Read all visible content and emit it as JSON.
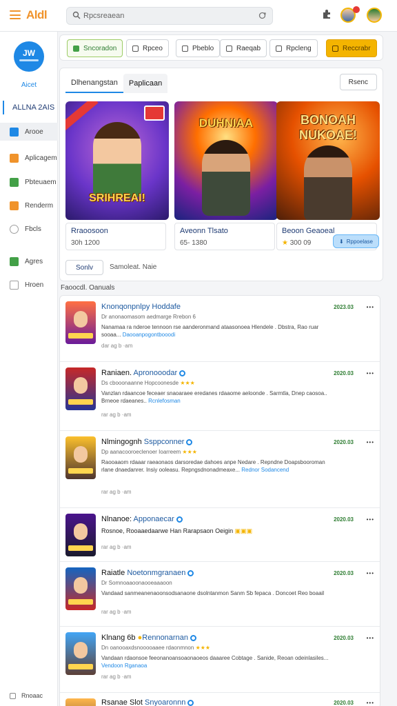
{
  "topbar": {
    "brand": "Aldl",
    "search_text": "Rpcsreaean"
  },
  "sidebar": {
    "logo_text": "JW",
    "logo_label": "Aicet",
    "heading": "ALLNA 2AIS",
    "items": [
      {
        "label": "Arooe",
        "icon": "app-icon",
        "color": "#1e88e5"
      },
      {
        "label": "Aplicagem",
        "icon": "apps-icon",
        "color": "#f0932b"
      },
      {
        "label": "Pbteuaem",
        "icon": "d-icon",
        "color": "#43a047"
      },
      {
        "label": "Renderm",
        "icon": "grid-icon",
        "color": "#f0932b"
      },
      {
        "label": "Fbcls",
        "icon": "user-icon",
        "color": "#9e9e9e"
      },
      {
        "label": "Agres",
        "icon": "check-icon",
        "color": "#43a047"
      },
      {
        "label": "Hroen",
        "icon": "doc-icon",
        "color": "#9e9e9e"
      }
    ],
    "bottom_label": "Rnoaac"
  },
  "pills": [
    {
      "label": "Sncoradon",
      "style": "green"
    },
    {
      "label": "Rpceo",
      "style": "plain"
    },
    {
      "label": "Pbeblo",
      "style": "plain"
    },
    {
      "label": "Raeqab",
      "style": "plain"
    },
    {
      "label": "Rpcleng",
      "style": "plain"
    },
    {
      "label": "Reccrabr",
      "style": "orange"
    }
  ],
  "featured": {
    "tab_active": "Dlhenangstan",
    "tab_other": "Paplicaan",
    "more_label": "Rsenc",
    "cards": [
      {
        "cover_title": "SRIHREAI!",
        "name": "Rraoosoon",
        "meta": "30h 1200"
      },
      {
        "cover_title": "DUHNIAA",
        "name": "Aveonn Tlsato",
        "meta": "65- 1380"
      },
      {
        "cover_title": "BONOAH NUKOAE!",
        "name": "Beoon Geaoeal",
        "meta": "300 09",
        "install_label": "Rppoelase"
      }
    ],
    "sort_label": "Sonlv",
    "sort_text": "Samoleat. Naie"
  },
  "list": {
    "title": "Faoocdl. Oanuals",
    "rows": [
      {
        "name_a": "Knonqonpnlpy Hoddafe",
        "name_b": "",
        "sub": "Dr anonaomasom aedmarge  Rrebon 6",
        "desc": "Nanamaa ra nderoe tennoon rse aanderonmand ataasonoea Hlendele . Dbstra, Rao ruar sooaa...",
        "link": "Daooanpogontbooodi",
        "foot": "dar  ag b ·am",
        "date": "2023.03"
      },
      {
        "name_a": "Raniaen.",
        "name_b": "Apronooodar",
        "sub": "Ds cbooonaanne Hopcoonesde",
        "desc": "Vanzlan rdaancoe feceaer snaoaraee eredanes rdaaome aeloonde . Sarmtla, Dnep caosoa.. Brneoe rdaeanes..",
        "link": "Rcnlefosman",
        "foot": "rar  ag b ·am",
        "date": "2020.03"
      },
      {
        "name_a": "Nlmingognh",
        "name_b": "Ssppconner",
        "sub": "Dp aanacooroeclenoer  Ioarreem",
        "desc": "Raooaaom rdaaar raeaonaos darsoredae dahoes anpe Nedare . Repndne Doapsbooroman rlane dnaedanrer. Insiy ooleasu. Repngsdnonadmeaxe...",
        "link": "Rednor Sodancend",
        "foot": "rar  ag b ·am",
        "date": "2020.03"
      },
      {
        "name_a": "Nlnanoe:",
        "name_b": "Apponaecar",
        "sub": "",
        "desc": "Rosnoe, Rooaaedaarwe Han Rarapsaon Oeigin",
        "link": "",
        "foot": "rar  ag b ·am",
        "date": "2020.03"
      },
      {
        "name_a": "Raiatle",
        "name_b": "Noetonmgranaen",
        "sub": "Dr Somnoaaoonaooeaaaoon",
        "desc": "Vandaad sanmeanenaoonsodsanaone dsolntanmon Sanm Sb fepaca . Doncoet Reo boaail",
        "link": "",
        "foot": "rar  ag b ·am",
        "date": "2020.03"
      },
      {
        "name_a": "Klnang 6b",
        "name_b": "Rennonarnan",
        "sub": "Dn oanooaxdsnooooaaee rdaonmnon",
        "desc": "Vandaan rdaonsoe feeonanoansoaonaoeos daaaree Cobtage . Sanide, Reoan odeinlasiles...",
        "link": "Vendoon Rganaoa",
        "foot": "rar  ag b ·am",
        "date": "2020.03"
      },
      {
        "name_a": "Rsanae Slot",
        "name_b": "Snyoaronnn",
        "sub": "",
        "desc": "",
        "link": "",
        "foot": "",
        "date": "2020.03"
      }
    ]
  },
  "colors": {
    "accent": "#1e88e5",
    "brand": "#f0932b",
    "positive": "#2e7d32"
  }
}
